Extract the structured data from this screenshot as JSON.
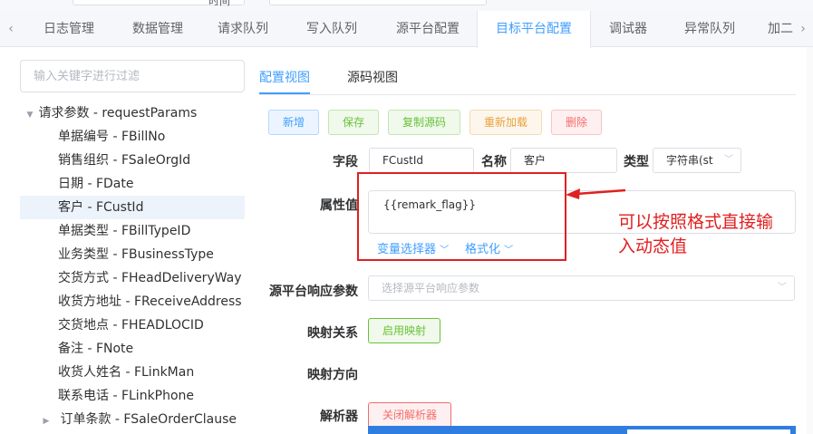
{
  "top": {
    "time_label": "时间"
  },
  "tabs": [
    "日志管理",
    "数据管理",
    "请求队列",
    "写入队列",
    "源平台配置",
    "目标平台配置",
    "调试器",
    "异常队列",
    "加二"
  ],
  "tab_nav": {
    "left": "‹",
    "right": "›"
  },
  "filter": {
    "placeholder": "输入关键字进行过滤",
    "value": ""
  },
  "tree": {
    "root": "请求参数 - requestParams",
    "items": [
      "单据编号 - FBillNo",
      "销售组织 - FSaleOrgId",
      "日期 - FDate",
      "客户 - FCustId",
      "单据类型 - FBillTypeID",
      "业务类型 - FBusinessType",
      "交货方式 - FHeadDeliveryWay",
      "收货方地址 - FReceiveAddress",
      "交货地点 - FHEADLOCID",
      "备注 - FNote",
      "收货人姓名 - FLinkMan",
      "联系电话 - FLinkPhone",
      "订单条款 - FSaleOrderClause"
    ]
  },
  "view_tabs": {
    "config": "配置视图",
    "source": "源码视图"
  },
  "actions": {
    "add": "新增",
    "save": "保存",
    "copy": "复制源码",
    "reload": "重新加载",
    "delete": "删除"
  },
  "form": {
    "field_label": "字段",
    "field_value": "FCustId",
    "name_label": "名称",
    "name_value": "客户",
    "type_label": "类型",
    "type_value": "字符串(st",
    "attr_label": "属性值",
    "attr_value": "{{remark_flag}}",
    "var_selector": "变量选择器",
    "format": "格式化",
    "response_label": "源平台响应参数",
    "response_placeholder": "选择源平台响应参数",
    "mapping_label": "映射关系",
    "mapping_btn": "启用映射",
    "direction_label": "映射方向",
    "parser_label": "解析器",
    "parser_btn": "关闭解析器"
  },
  "annotation": {
    "line1": "可以按照格式直接输",
    "line2": "入动态值"
  }
}
